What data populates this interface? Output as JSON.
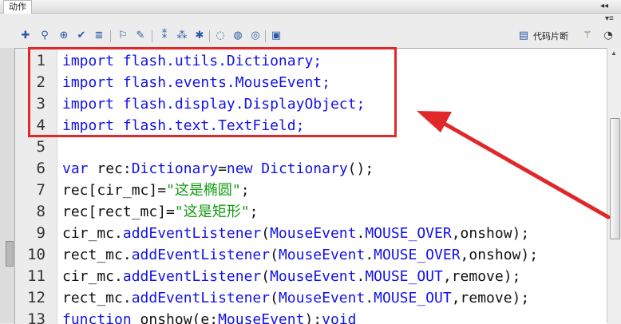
{
  "window": {
    "panel_title": "动作",
    "close_glyph": "◂◂",
    "menu_glyph": "▾≡"
  },
  "toolbar": {
    "icons": [
      "add-statement-icon",
      "find-icon",
      "target-icon",
      "check-syntax-icon",
      "format-icon",
      "insert-target-path-icon",
      "script-assist-icon",
      "debug-options-icon",
      "collapse-between-braces-icon",
      "collapse-selection-icon",
      "expand-all-icon",
      "apply-block-comment-icon",
      "apply-line-comment-icon",
      "remove-comment-icon",
      "show-hide-toolbox-icon"
    ],
    "snippets_label": "代码片断",
    "wand_icon": "magic-wand-icon",
    "help_icon": "help-icon"
  },
  "editor": {
    "line_numbers": [
      "1",
      "2",
      "3",
      "4",
      "5",
      "6",
      "7",
      "8",
      "9",
      "10",
      "11",
      "12",
      "13"
    ],
    "lines": [
      [
        {
          "t": "import",
          "c": "kw"
        },
        {
          "t": " flash.utils.Dictionary;",
          "c": "kw"
        }
      ],
      [
        {
          "t": "import",
          "c": "kw"
        },
        {
          "t": " flash.events.MouseEvent;",
          "c": "kw"
        }
      ],
      [
        {
          "t": "import",
          "c": "kw"
        },
        {
          "t": " flash.display.DisplayObject;",
          "c": "kw"
        }
      ],
      [
        {
          "t": "import",
          "c": "kw"
        },
        {
          "t": " flash.text.TextField;",
          "c": "kw"
        }
      ],
      [],
      [
        {
          "t": "var",
          "c": "kw"
        },
        {
          "t": " rec:",
          "c": "pl"
        },
        {
          "t": "Dictionary",
          "c": "kw"
        },
        {
          "t": "=",
          "c": "pl"
        },
        {
          "t": "new",
          "c": "kw"
        },
        {
          "t": " ",
          "c": "pl"
        },
        {
          "t": "Dictionary",
          "c": "kw"
        },
        {
          "t": "();",
          "c": "pl"
        }
      ],
      [
        {
          "t": "rec[cir_mc]=",
          "c": "pl"
        },
        {
          "t": "\"这是椭圆\"",
          "c": "str"
        },
        {
          "t": ";",
          "c": "pl"
        }
      ],
      [
        {
          "t": "rec[rect_mc]=",
          "c": "pl"
        },
        {
          "t": "\"这是矩形\"",
          "c": "str"
        },
        {
          "t": ";",
          "c": "pl"
        }
      ],
      [
        {
          "t": "cir_mc.",
          "c": "pl"
        },
        {
          "t": "addEventListener",
          "c": "kw"
        },
        {
          "t": "(",
          "c": "pl"
        },
        {
          "t": "MouseEvent",
          "c": "kw"
        },
        {
          "t": ".",
          "c": "pl"
        },
        {
          "t": "MOUSE_OVER",
          "c": "kw"
        },
        {
          "t": ",onshow);",
          "c": "pl"
        }
      ],
      [
        {
          "t": "rect_mc.",
          "c": "pl"
        },
        {
          "t": "addEventListener",
          "c": "kw"
        },
        {
          "t": "(",
          "c": "pl"
        },
        {
          "t": "MouseEvent",
          "c": "kw"
        },
        {
          "t": ".",
          "c": "pl"
        },
        {
          "t": "MOUSE_OVER",
          "c": "kw"
        },
        {
          "t": ",onshow);",
          "c": "pl"
        }
      ],
      [
        {
          "t": "cir_mc.",
          "c": "pl"
        },
        {
          "t": "addEventListener",
          "c": "kw"
        },
        {
          "t": "(",
          "c": "pl"
        },
        {
          "t": "MouseEvent",
          "c": "kw"
        },
        {
          "t": ".",
          "c": "pl"
        },
        {
          "t": "MOUSE_OUT",
          "c": "kw"
        },
        {
          "t": ",remove);",
          "c": "pl"
        }
      ],
      [
        {
          "t": "rect_mc.",
          "c": "pl"
        },
        {
          "t": "addEventListener",
          "c": "kw"
        },
        {
          "t": "(",
          "c": "pl"
        },
        {
          "t": "MouseEvent",
          "c": "kw"
        },
        {
          "t": ".",
          "c": "pl"
        },
        {
          "t": "MOUSE_OUT",
          "c": "kw"
        },
        {
          "t": ",remove);",
          "c": "pl"
        }
      ],
      [
        {
          "t": "function",
          "c": "kw"
        },
        {
          "t": " onshow(e:",
          "c": "pl"
        },
        {
          "t": "MouseEvent",
          "c": "kw"
        },
        {
          "t": "):",
          "c": "pl"
        },
        {
          "t": "void",
          "c": "kw"
        }
      ]
    ]
  },
  "annotation": {
    "box_color": "#e0272a",
    "arrow_color": "#e0272a"
  }
}
